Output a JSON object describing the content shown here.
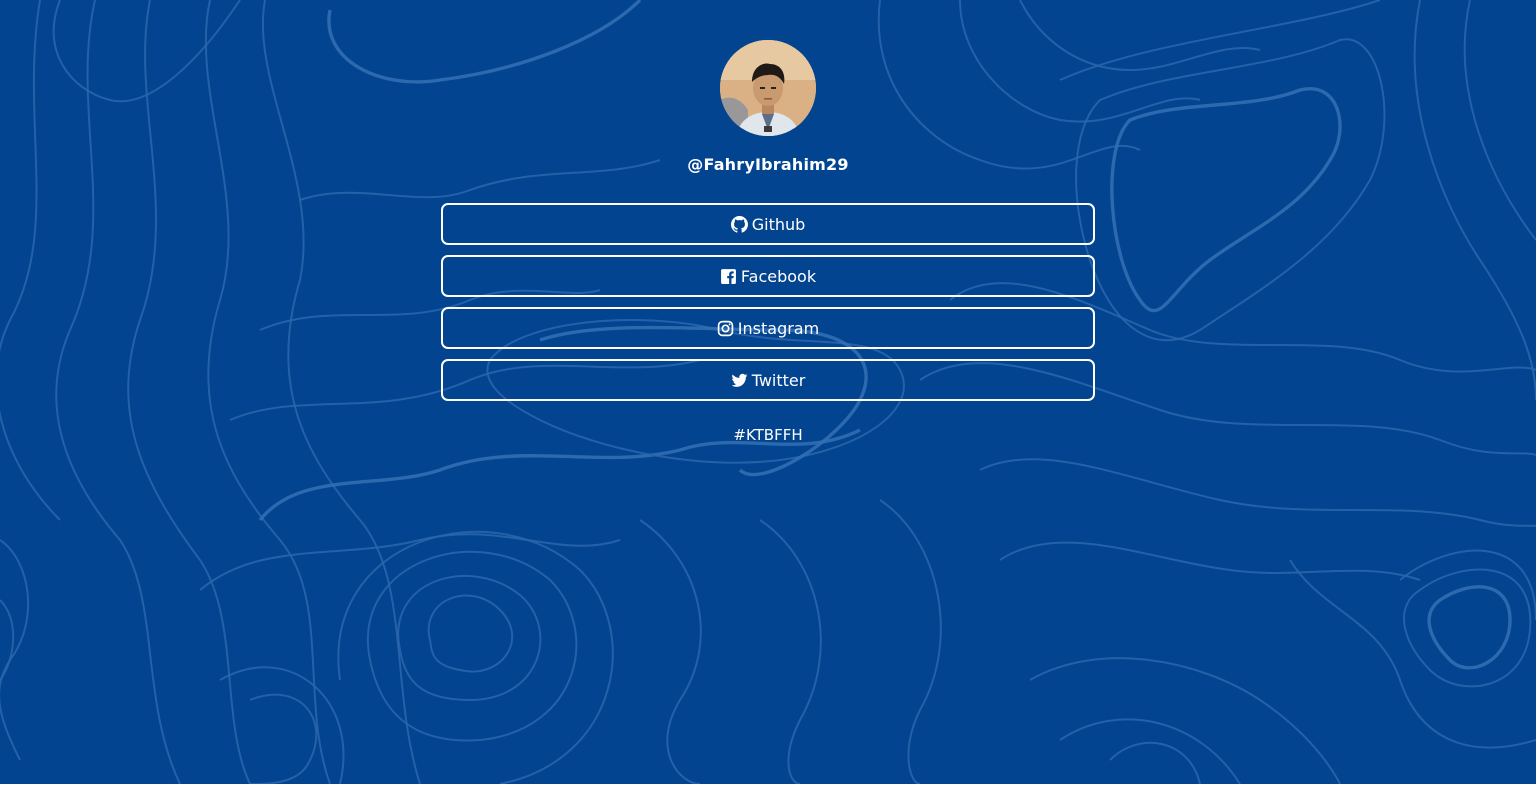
{
  "profile": {
    "username": "@FahryIbrahim29",
    "avatar_icon": "profile-photo"
  },
  "links": [
    {
      "label": "Github",
      "icon": "github-icon"
    },
    {
      "label": "Facebook",
      "icon": "facebook-icon"
    },
    {
      "label": "Instagram",
      "icon": "instagram-icon"
    },
    {
      "label": "Twitter",
      "icon": "twitter-icon"
    }
  ],
  "footer": {
    "hashtag": "#KTBFFH"
  },
  "colors": {
    "background": "#02448f",
    "contour": "#2a66ad",
    "text": "#ffffff"
  }
}
